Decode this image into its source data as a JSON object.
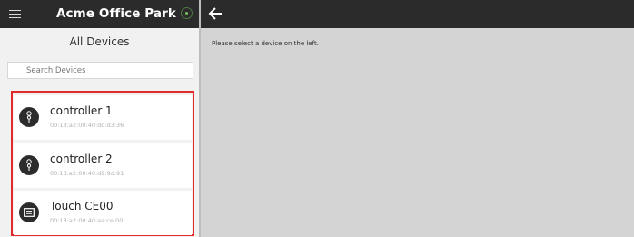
{
  "header": {
    "app_title": "Acme Office Park",
    "menu_icon": "hamburger-icon",
    "status_icon": "connected-status-icon",
    "back_icon": "back-arrow-icon"
  },
  "sidebar": {
    "title": "All Devices",
    "search_placeholder": "Search Devices",
    "devices": [
      {
        "name": "controller 1",
        "mac": "00:13:a2:00:40:dd:d3:36",
        "icon": "controller-icon"
      },
      {
        "name": "controller 2",
        "mac": "00:13:a2:00:40:d9:9d:91",
        "icon": "controller-icon"
      },
      {
        "name": "Touch CE00",
        "mac": "00:13:a2:00:40:aa:ce:00",
        "icon": "touch-panel-icon"
      }
    ]
  },
  "main": {
    "message": "Please select a device on the left."
  },
  "colors": {
    "topbar": "#2b2b2b",
    "sidebar_bg": "#f1f1f1",
    "main_bg": "#d4d4d4",
    "highlight_border": "#e32a2a",
    "status_green": "#7fbf5c"
  }
}
